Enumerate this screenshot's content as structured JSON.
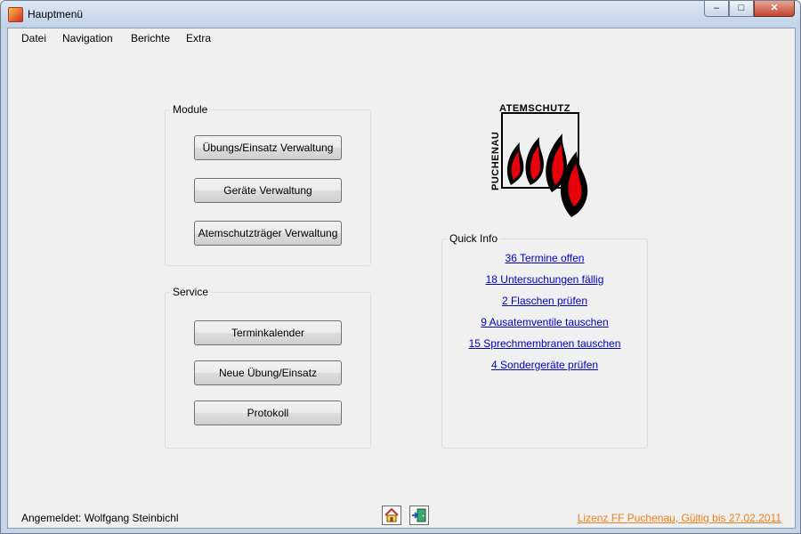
{
  "window": {
    "title": "Hauptmenü",
    "buttons": {
      "minimize": "–",
      "maximize": "□",
      "close": "✕"
    }
  },
  "menu": [
    "Datei",
    "Navigation",
    "Berichte",
    "Extra"
  ],
  "module_group": {
    "legend": "Module",
    "buttons": [
      "Übungs/Einsatz Verwaltung",
      "Geräte Verwaltung",
      "Atemschutzträger Verwaltung"
    ]
  },
  "service_group": {
    "legend": "Service",
    "buttons": [
      "Terminkalender",
      "Neue Übung/Einsatz",
      "Protokoll"
    ]
  },
  "logo": {
    "text_top": "ATEMSCHUTZ",
    "text_side": "PUCHENAU"
  },
  "quick_info": {
    "legend": "Quick Info",
    "links": [
      "36 Termine offen",
      "18 Untersuchungen fällig",
      "2 Flaschen prüfen",
      "9 Ausatemventile tauschen",
      "15 Sprechmembranen tauschen",
      "4 Sondergeräte prüfen"
    ]
  },
  "status": {
    "logged_in": "Angemeldet: Wolfgang Steinbichl",
    "license": "Lizenz FF Puchenau, Gültig bis 27.02.2011"
  },
  "icons": {
    "home": "home-icon",
    "exit": "exit-door-icon"
  },
  "colors": {
    "link": "#0000cc",
    "license": "#f07d1a",
    "flame_red": "#e8000b"
  }
}
